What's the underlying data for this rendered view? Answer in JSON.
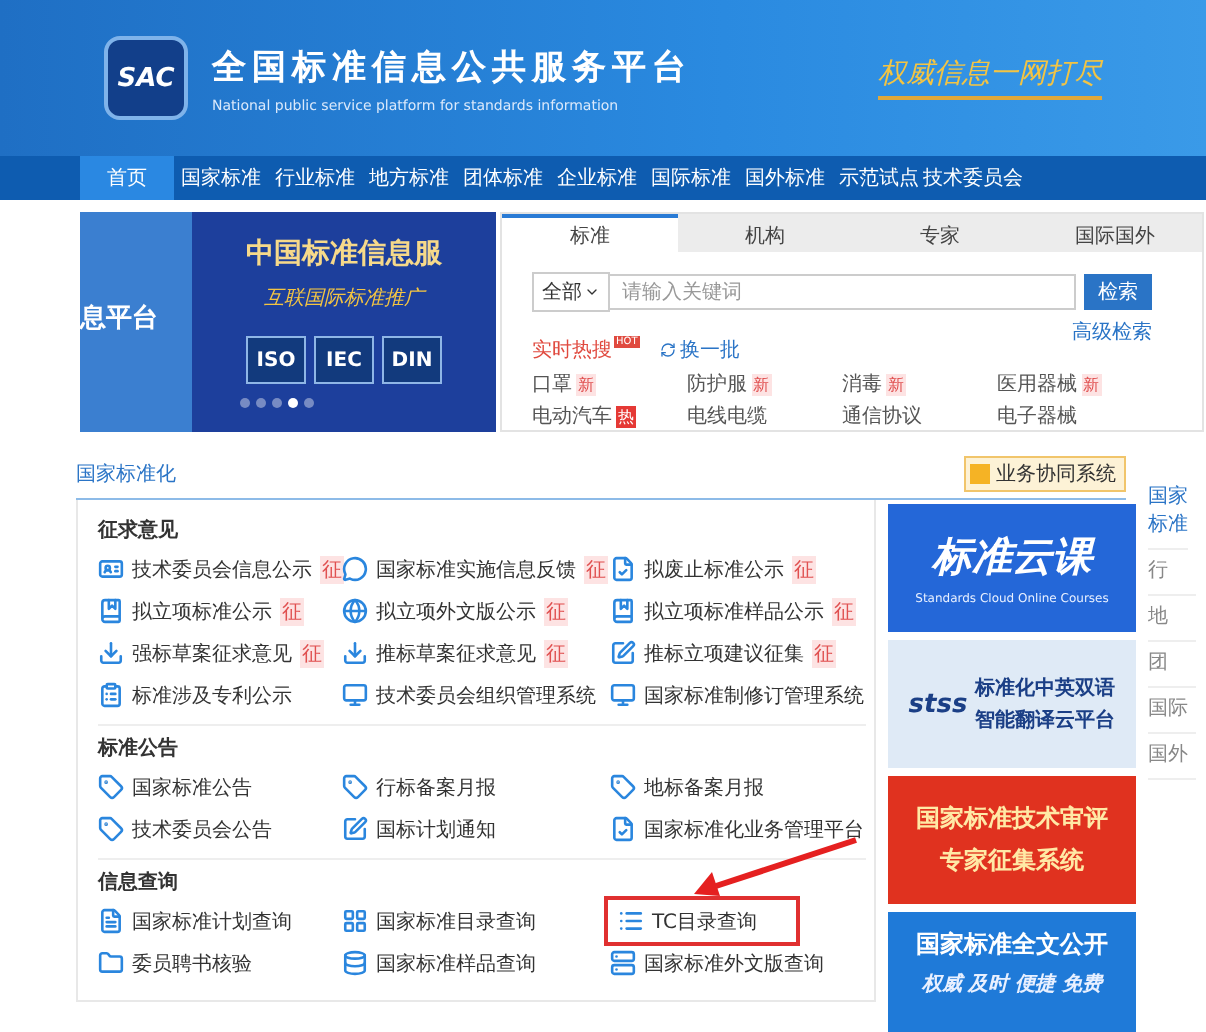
{
  "header": {
    "logo": "SAC",
    "title": "全国标准信息公共服务平台",
    "subtitle": "National public service platform  for standards information",
    "slogan": "权威信息一网打尽"
  },
  "nav": [
    {
      "label": "首页",
      "selected": true
    },
    {
      "label": "国家标准",
      "selected": false
    },
    {
      "label": "行业标准",
      "selected": false
    },
    {
      "label": "地方标准",
      "selected": false
    },
    {
      "label": "团体标准",
      "selected": false
    },
    {
      "label": "企业标准",
      "selected": false
    },
    {
      "label": "国际标准",
      "selected": false
    },
    {
      "label": "国外标准",
      "selected": false
    },
    {
      "label": "示范试点",
      "selected": false
    },
    {
      "label": "技术委员会",
      "selected": false
    }
  ],
  "carousel": {
    "left_text": "息平台",
    "title": "中国标准信息服",
    "subtitle": "互联国际标准推广",
    "logos": [
      "ISO",
      "IEC",
      "DIN"
    ],
    "dots": [
      {
        "selected": false
      },
      {
        "selected": false
      },
      {
        "selected": false
      },
      {
        "selected": true
      },
      {
        "selected": false
      }
    ]
  },
  "search": {
    "tabs": [
      {
        "label": "标准",
        "selected": true
      },
      {
        "label": "机构",
        "selected": false
      },
      {
        "label": "专家",
        "selected": false
      },
      {
        "label": "国际国外",
        "selected": false
      }
    ],
    "scope": "全部",
    "placeholder": "请输入关键词",
    "button": "检索",
    "advanced": "高级检索",
    "hot_label": "实时热搜",
    "hot_badge": "HOT",
    "refresh": "换一批",
    "keywords": [
      {
        "label": "口罩",
        "badge": "新",
        "kind": "new"
      },
      {
        "label": "防护服",
        "badge": "新",
        "kind": "new"
      },
      {
        "label": "消毒",
        "badge": "新",
        "kind": "new"
      },
      {
        "label": "医用器械",
        "badge": "新",
        "kind": "new"
      },
      {
        "label": "电动汽车",
        "badge": "热",
        "kind": "hot"
      },
      {
        "label": "电线电缆",
        "kind": "plain"
      },
      {
        "label": "通信协议",
        "kind": "plain"
      },
      {
        "label": "电子器械",
        "kind": "plain"
      }
    ]
  },
  "section_title": "国家标准化",
  "collab_button": "业务协同系统",
  "groups": [
    {
      "title": "征求意见",
      "items": [
        {
          "label": "技术委员会信息公示",
          "badge": "征"
        },
        {
          "label": "国家标准实施信息反馈",
          "badge": "征"
        },
        {
          "label": "拟废止标准公示",
          "badge": "征"
        },
        {
          "label": "拟立项标准公示",
          "badge": "征"
        },
        {
          "label": "拟立项外文版公示",
          "badge": "征"
        },
        {
          "label": "拟立项标准样品公示",
          "badge": "征"
        },
        {
          "label": "强标草案征求意见",
          "badge": "征"
        },
        {
          "label": "推标草案征求意见",
          "badge": "征"
        },
        {
          "label": "推标立项建议征集",
          "badge": "征"
        },
        {
          "label": "标准涉及专利公示"
        },
        {
          "label": "技术委员会组织管理系统"
        },
        {
          "label": "国家标准制修订管理系统"
        }
      ]
    },
    {
      "title": "标准公告",
      "items": [
        {
          "label": "国家标准公告"
        },
        {
          "label": "行标备案月报"
        },
        {
          "label": "地标备案月报"
        },
        {
          "label": "技术委员会公告"
        },
        {
          "label": "国标计划通知"
        },
        {
          "label": "国家标准化业务管理平台"
        }
      ]
    },
    {
      "title": "信息查询",
      "items": [
        {
          "label": "国家标准计划查询",
          "highlighted": false
        },
        {
          "label": "国家标准目录查询",
          "highlighted": false
        },
        {
          "label": "TC目录查询",
          "highlighted": true
        },
        {
          "label": "委员聘书核验",
          "highlighted": false
        },
        {
          "label": "国家标准样品查询",
          "highlighted": false
        },
        {
          "label": "国家标准外文版查询",
          "highlighted": false
        }
      ]
    }
  ],
  "banners": [
    {
      "kind": "course",
      "title": "标准云课",
      "subtitle": "Standards Cloud Online Courses"
    },
    {
      "kind": "translate",
      "logo": "stss",
      "title": "标准化中英双语",
      "subtitle": "智能翻译云平台"
    },
    {
      "kind": "expert",
      "title": "国家标准技术审评",
      "subtitle": "专家征集系统"
    },
    {
      "kind": "fulltext",
      "title": "国家标准全文公开",
      "subtitle": "权威  及时  便捷  免费"
    }
  ],
  "side_links": [
    "国家标准",
    "行",
    "地",
    "团",
    "国际",
    "国外"
  ]
}
